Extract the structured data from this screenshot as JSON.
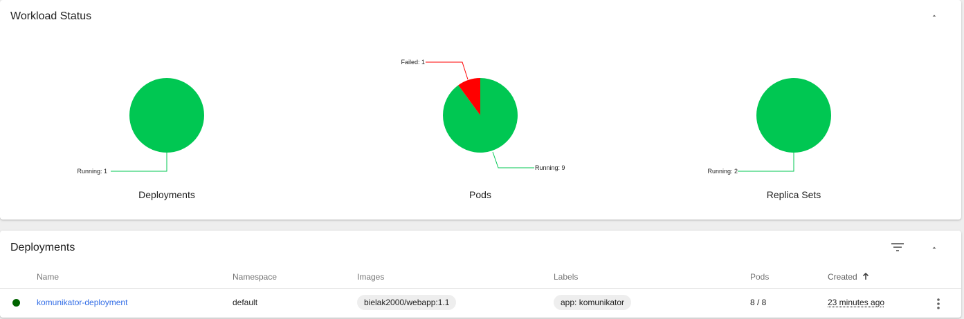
{
  "workload_status": {
    "title": "Workload Status",
    "charts": [
      {
        "name": "Deployments",
        "slices": [
          {
            "label": "Running: 1",
            "value": 1,
            "color": "#00c752"
          }
        ]
      },
      {
        "name": "Pods",
        "slices": [
          {
            "label": "Running: 9",
            "value": 9,
            "color": "#00c752"
          },
          {
            "label": "Failed: 1",
            "value": 1,
            "color": "#ff0000"
          }
        ]
      },
      {
        "name": "Replica Sets",
        "slices": [
          {
            "label": "Running: 2",
            "value": 2,
            "color": "#00c752"
          }
        ]
      }
    ]
  },
  "deployments": {
    "title": "Deployments",
    "columns": {
      "name": "Name",
      "namespace": "Namespace",
      "images": "Images",
      "labels": "Labels",
      "pods": "Pods",
      "created": "Created"
    },
    "sort_icon": "arrow-up-icon",
    "rows": [
      {
        "status": "running",
        "status_color": "#006400",
        "name": "komunikator-deployment",
        "namespace": "default",
        "image": "bielak2000/webapp:1.1",
        "label": "app: komunikator",
        "pods": "8 / 8",
        "created": "23 minutes ago"
      }
    ]
  },
  "colors": {
    "link": "#326de6",
    "running": "#00c752",
    "failed": "#ff0000"
  }
}
